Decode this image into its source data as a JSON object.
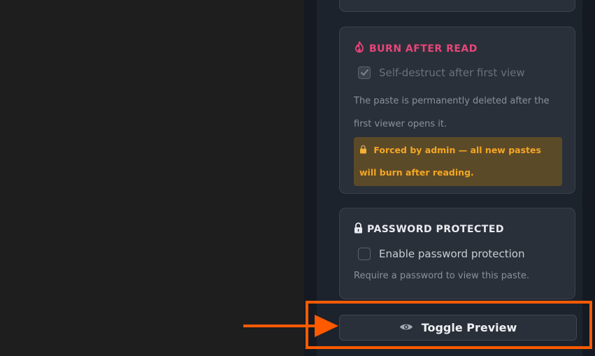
{
  "burn_section": {
    "title": "BURN AFTER READ",
    "checkbox_label": "Self-destruct after first view",
    "checked": true,
    "description": "The paste is permanently deleted after the first viewer opens it.",
    "notice": "Forced by admin — all new pastes will burn after reading.",
    "title_color": "#e8457a",
    "notice_color": "#f5a623"
  },
  "password_section": {
    "title": "PASSWORD PROTECTED",
    "checkbox_label": "Enable password protection",
    "checked": false,
    "description": "Require a password to view this paste."
  },
  "preview_button": {
    "label": "Toggle Preview"
  },
  "annotation": {
    "color": "#ff5a00"
  }
}
